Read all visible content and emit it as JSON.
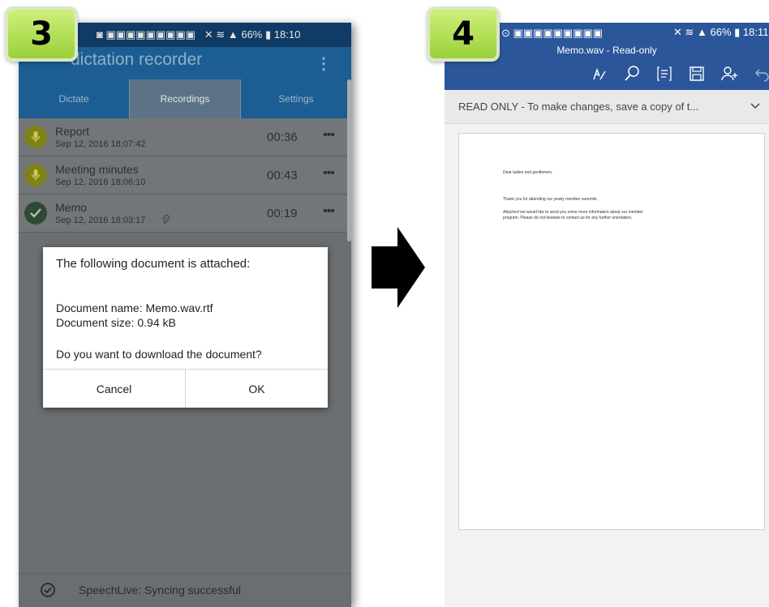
{
  "step_left": {
    "number": "3"
  },
  "step_right": {
    "number": "4"
  },
  "left_phone": {
    "status": {
      "battery": "66%",
      "time": "18:10"
    },
    "app_title": "dictation recorder",
    "tabs": [
      "Dictate",
      "Recordings",
      "Settings"
    ],
    "recordings": [
      {
        "name": "Report",
        "date": "Sep 12, 2016 18:07:42",
        "duration": "00:36"
      },
      {
        "name": "Meeting minutes",
        "date": "Sep 12, 2016 18:06:10",
        "duration": "00:43"
      },
      {
        "name": "Memo",
        "date": "Sep 12, 2016 18:03:17",
        "duration": "00:19"
      }
    ],
    "more_label": "•••",
    "dialog": {
      "heading": "The following document is attached:",
      "doc_name": "Document name: Memo.wav.rtf",
      "doc_size": "Document size: 0.94 kB",
      "question": "Do you want to download the document?",
      "cancel": "Cancel",
      "ok": "OK"
    },
    "bottom_status": "SpeechLive: Syncing successful"
  },
  "right_phone": {
    "status": {
      "battery": "66%",
      "time": "18:11"
    },
    "title": "Memo.wav - Read-only",
    "banner": "READ ONLY - To make changes, save a copy of t...",
    "document": {
      "greeting": "Dear ladies and gentlemen,",
      "line1": "Thank you for attending our yearly member summits.",
      "line2": "Attached we would like to send you some more information about our member",
      "line3": "program. Please do not hesitate to contact us for any further orientation."
    }
  },
  "colors": {
    "word_blue": "#2b579a",
    "app_blue": "#1c5e93",
    "badge_green": "#b5e14f"
  }
}
